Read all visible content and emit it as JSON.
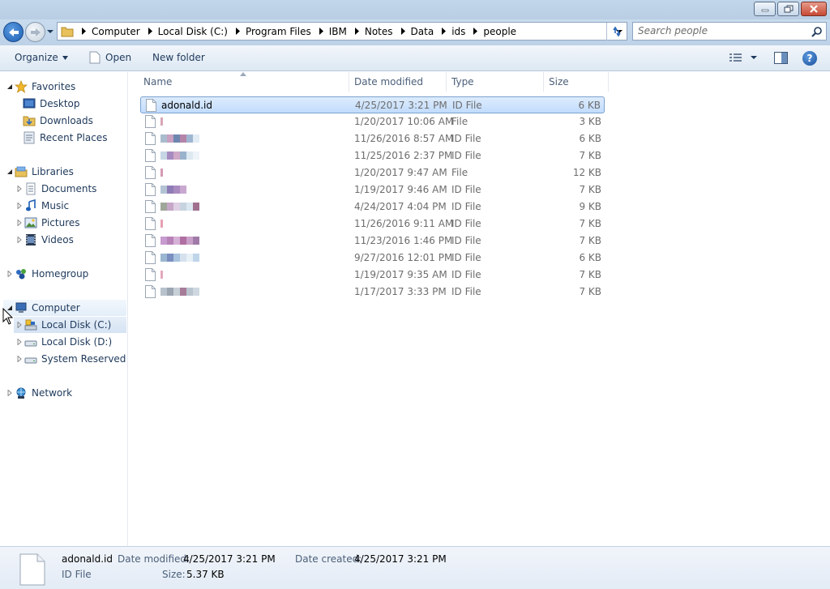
{
  "window": {
    "minimize_icon": "minimize-icon",
    "maximize_icon": "restore-icon",
    "close_icon": "close-icon"
  },
  "address": {
    "crumbs": [
      "Computer",
      "Local Disk (C:)",
      "Program Files",
      "IBM",
      "Notes",
      "Data",
      "ids",
      "people"
    ]
  },
  "search": {
    "placeholder": "Search people"
  },
  "toolbar": {
    "organize_label": "Organize",
    "open_label": "Open",
    "new_folder_label": "New folder"
  },
  "nav": {
    "favorites": "Favorites",
    "desktop": "Desktop",
    "downloads": "Downloads",
    "recent_places": "Recent Places",
    "libraries": "Libraries",
    "documents": "Documents",
    "music": "Music",
    "pictures": "Pictures",
    "videos": "Videos",
    "homegroup": "Homegroup",
    "computer": "Computer",
    "local_c": "Local Disk (C:)",
    "local_d": "Local Disk (D:)",
    "system_reserved": "System Reserved (F:)",
    "network": "Network"
  },
  "columns": {
    "name": "Name",
    "date": "Date modified",
    "type": "Type",
    "size": "Size"
  },
  "files": [
    {
      "name": "adonald.id",
      "date": "4/25/2017 3:21 PM",
      "type": "ID File",
      "size": "6 KB",
      "selected": true
    },
    {
      "name": "",
      "date": "1/20/2017 10:06 AM",
      "type": "File",
      "size": "3 KB"
    },
    {
      "name": "",
      "date": "11/26/2016 8:57 AM",
      "type": "ID File",
      "size": "6 KB"
    },
    {
      "name": "",
      "date": "11/25/2016 2:37 PM",
      "type": "ID File",
      "size": "7 KB"
    },
    {
      "name": "",
      "date": "1/20/2017 9:47 AM",
      "type": "File",
      "size": "12 KB"
    },
    {
      "name": "",
      "date": "1/19/2017 9:46 AM",
      "type": "ID File",
      "size": "7 KB"
    },
    {
      "name": "",
      "date": "4/24/2017 4:04 PM",
      "type": "ID File",
      "size": "9 KB"
    },
    {
      "name": "",
      "date": "11/26/2016 9:11 AM",
      "type": "ID File",
      "size": "7 KB"
    },
    {
      "name": "",
      "date": "11/23/2016 1:46 PM",
      "type": "ID File",
      "size": "7 KB"
    },
    {
      "name": "",
      "date": "9/27/2016 12:01 PM",
      "type": "ID File",
      "size": "6 KB"
    },
    {
      "name": "",
      "date": "1/19/2017 9:35 AM",
      "type": "ID File",
      "size": "7 KB"
    },
    {
      "name": "",
      "date": "1/17/2017 3:33 PM",
      "type": "ID File",
      "size": "7 KB"
    }
  ],
  "details": {
    "name": "adonald.id",
    "type": "ID File",
    "date_modified_label": "Date modified:",
    "date_modified": "4/25/2017 3:21 PM",
    "date_created_label": "Date created:",
    "date_created": "4/25/2017 3:21 PM",
    "size_label": "Size:",
    "size": "5.37 KB"
  },
  "colors": {
    "accent": "#1e395b",
    "selection": "#c2dcfd",
    "muted_text": "#6d6d6d"
  }
}
